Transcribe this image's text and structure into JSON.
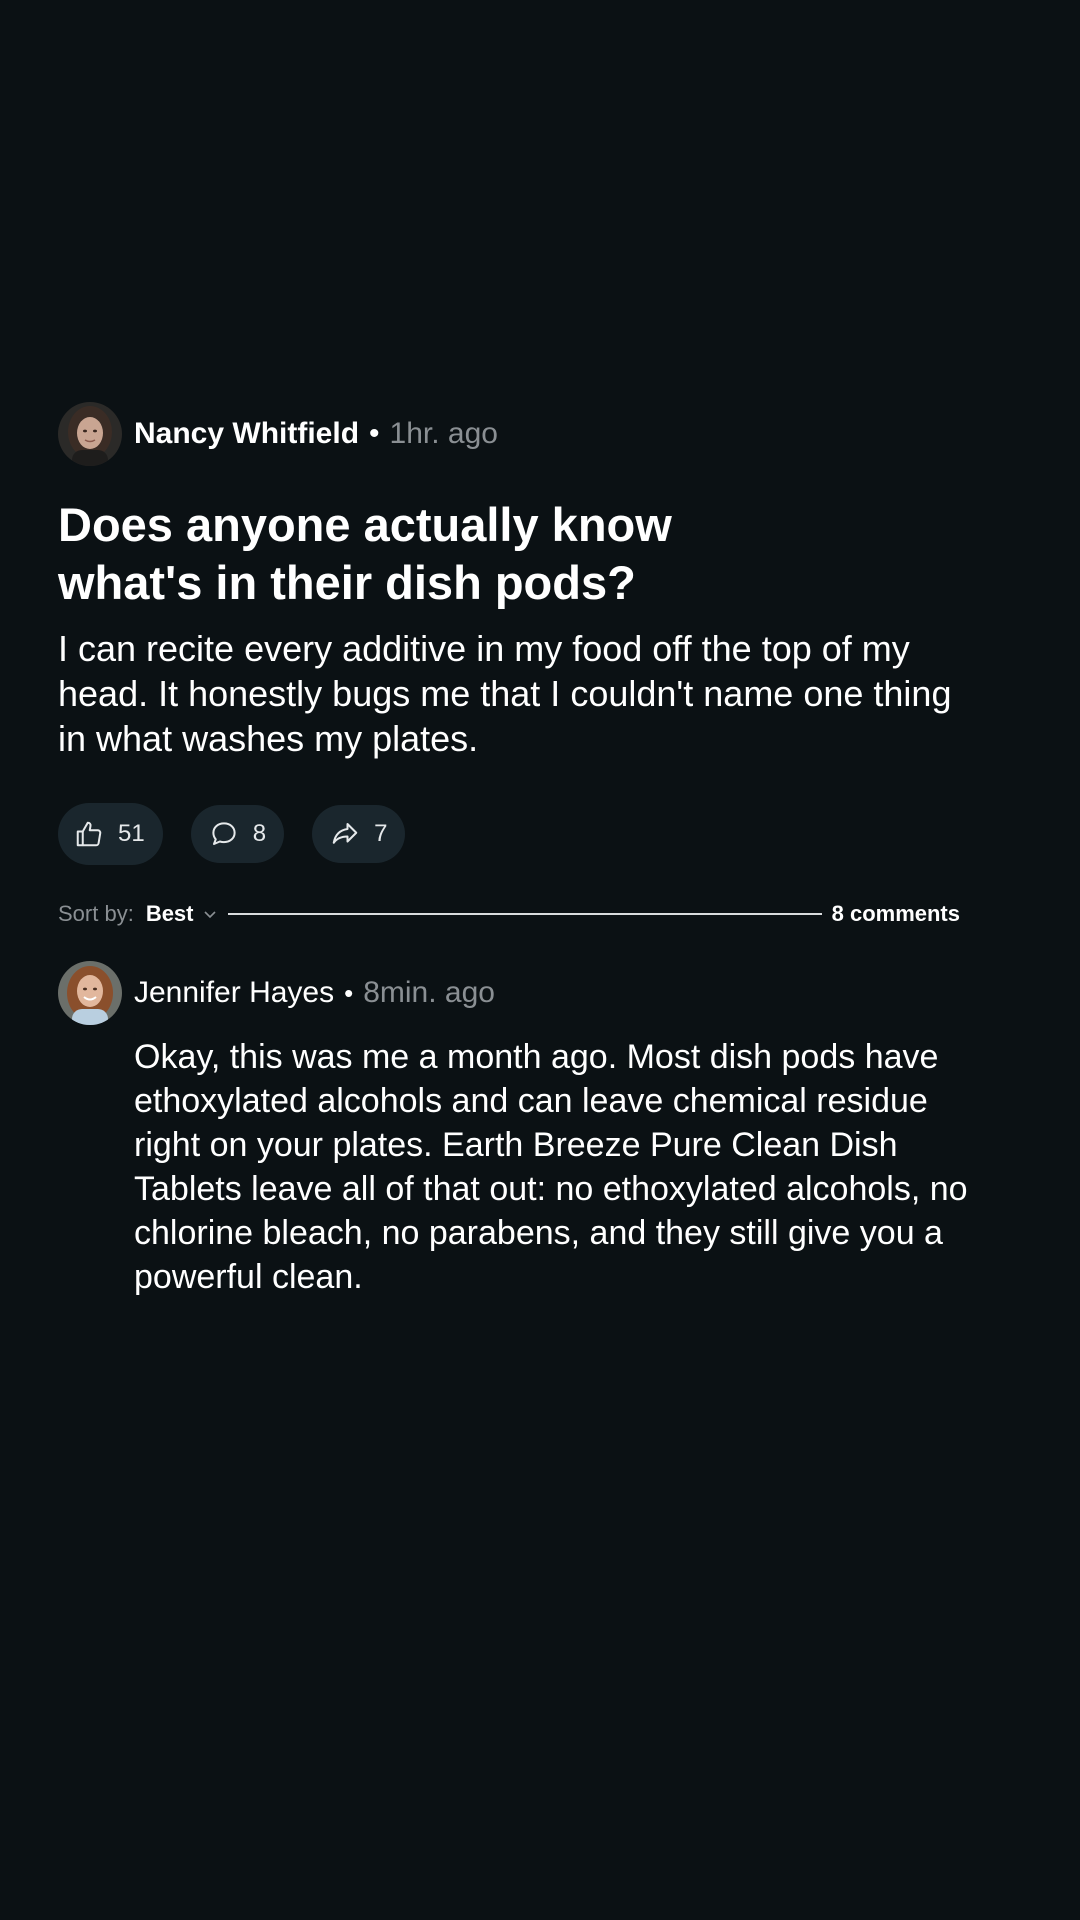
{
  "post": {
    "author": "Nancy Whitfield",
    "separator": "•",
    "time": "1hr. ago",
    "title": "Does anyone actually know what's in their dish pods?",
    "body": "I can recite every additive in my food off the top of my head. It honestly bugs me that I couldn't name one thing in what washes my plates.",
    "likes": "51",
    "comments": "8",
    "shares": "7",
    "avatar_icon": "user-avatar-photo"
  },
  "sort": {
    "label": "Sort by:",
    "value": "Best",
    "comment_count": "8 comments"
  },
  "comment": {
    "author": "Jennifer Hayes",
    "separator": "•",
    "time": "8min. ago",
    "body": "Okay, this was me a month ago. Most dish pods have ethoxylated alcohols and can leave chemical residue right on your plates. Earth Breeze Pure Clean Dish Tablets leave all of that out: no ethoxylated alcohols, no chlorine bleach, no parabens, and they still give you a powerful clean.",
    "avatar_icon": "user-avatar-photo"
  },
  "colors": {
    "background": "#0b1114",
    "button_bg": "#1a262d",
    "muted_text": "#8a8f93",
    "text": "#ffffff"
  }
}
